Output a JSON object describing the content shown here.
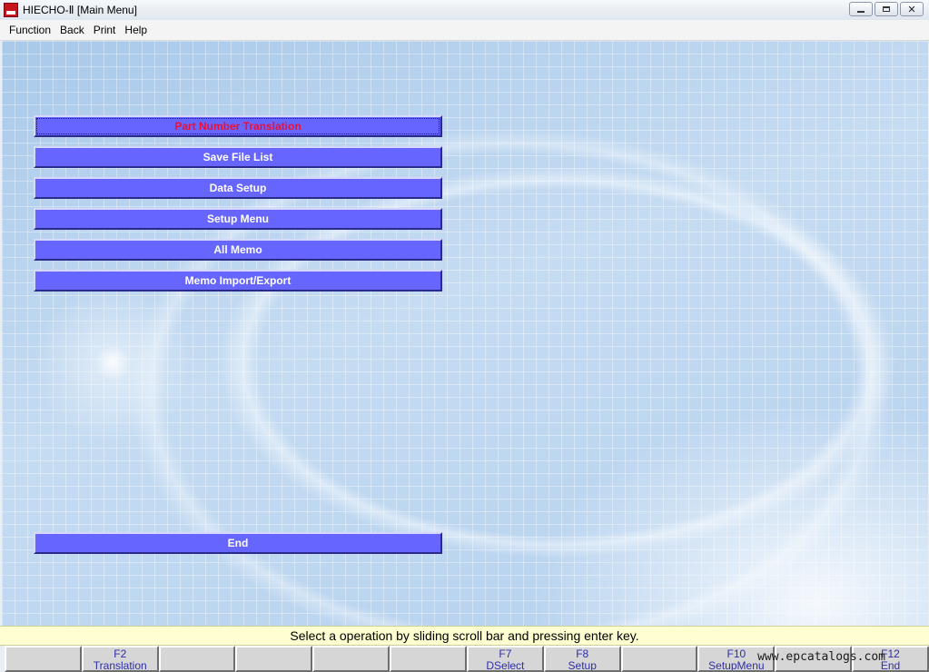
{
  "window": {
    "title": "HIECHO-Ⅱ [Main Menu]",
    "icon": "app-logo-icon",
    "controls": [
      "minimize-icon",
      "maximize-icon",
      "close-icon"
    ]
  },
  "menubar": {
    "items": [
      "Function",
      "Back",
      "Print",
      "Help"
    ]
  },
  "main_menu": {
    "buttons": [
      {
        "label": "Part Number Translation",
        "selected": true
      },
      {
        "label": "Save File List",
        "selected": false
      },
      {
        "label": "Data Setup",
        "selected": false
      },
      {
        "label": "Setup Menu",
        "selected": false
      },
      {
        "label": "All Memo",
        "selected": false
      },
      {
        "label": "Memo Import/Export",
        "selected": false
      }
    ],
    "end_label": "End"
  },
  "status": {
    "message": "Select a operation by sliding scroll bar and pressing enter key."
  },
  "fkeys": [
    {
      "key": "",
      "label": ""
    },
    {
      "key": "F2",
      "label": "Translation"
    },
    {
      "key": "",
      "label": ""
    },
    {
      "key": "",
      "label": ""
    },
    {
      "key": "",
      "label": ""
    },
    {
      "key": "",
      "label": ""
    },
    {
      "key": "F7",
      "label": "DSelect"
    },
    {
      "key": "F8",
      "label": "Setup"
    },
    {
      "key": "",
      "label": ""
    },
    {
      "key": "F10",
      "label": "SetupMenu"
    },
    {
      "key": "",
      "label": ""
    },
    {
      "key": "F12",
      "label": "End"
    }
  ],
  "watermark": "www.epcatalogs.com",
  "colors": {
    "button_bg": "#6666ff",
    "selected_text": "#e8113a",
    "status_bg": "#fefed0",
    "fkey_text": "#2e2ea8"
  }
}
